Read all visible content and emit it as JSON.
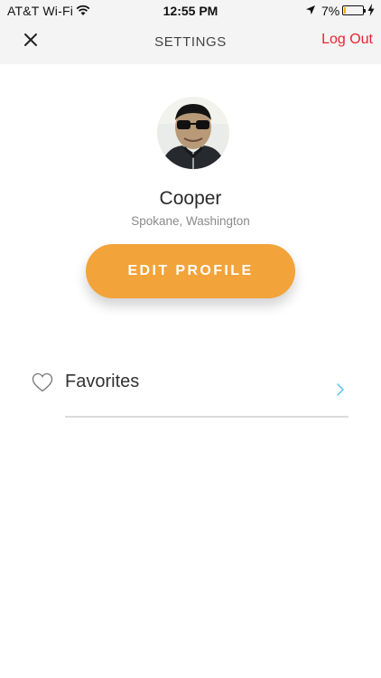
{
  "status_bar": {
    "carrier": "AT&T Wi-Fi",
    "time": "12:55 PM",
    "battery_percent": "7%",
    "battery_level": 0.07,
    "battery_color": "#e8b400",
    "icons": [
      "wifi-icon",
      "location-arrow-icon",
      "battery-icon",
      "charging-bolt-icon"
    ]
  },
  "nav": {
    "title": "SETTINGS",
    "logout_label": "Log Out",
    "logout_color": "#e8262c",
    "close_icon": "close-icon"
  },
  "profile": {
    "name": "Cooper",
    "location": "Spokane, Washington",
    "avatar": "profile-photo",
    "edit_label": "EDIT PROFILE",
    "edit_color": "#f2a33a"
  },
  "menu": {
    "items": [
      {
        "label": "Favorites",
        "icon": "heart-icon",
        "chevron": "chevron-right-icon"
      }
    ]
  }
}
